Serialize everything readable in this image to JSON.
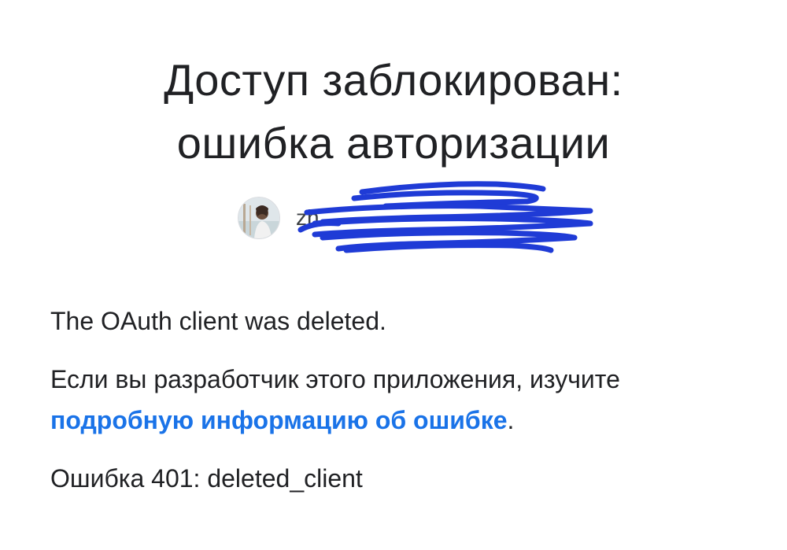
{
  "title": {
    "line1": "Доступ заблокирован:",
    "line2": "ошибка авторизации"
  },
  "account": {
    "email": "zh",
    "avatar_icon": "profile-photo-avatar",
    "redaction_color": "#1f3bd6"
  },
  "content": {
    "message": "The OAuth client was deleted.",
    "developer_prefix": "Если вы разработчик этого приложения, изучите ",
    "developer_link": "подробную информацию об ошибке",
    "developer_suffix": ".",
    "error_code": "Ошибка 401: deleted_client"
  },
  "colors": {
    "link": "#1a73e8",
    "text": "#202124"
  }
}
